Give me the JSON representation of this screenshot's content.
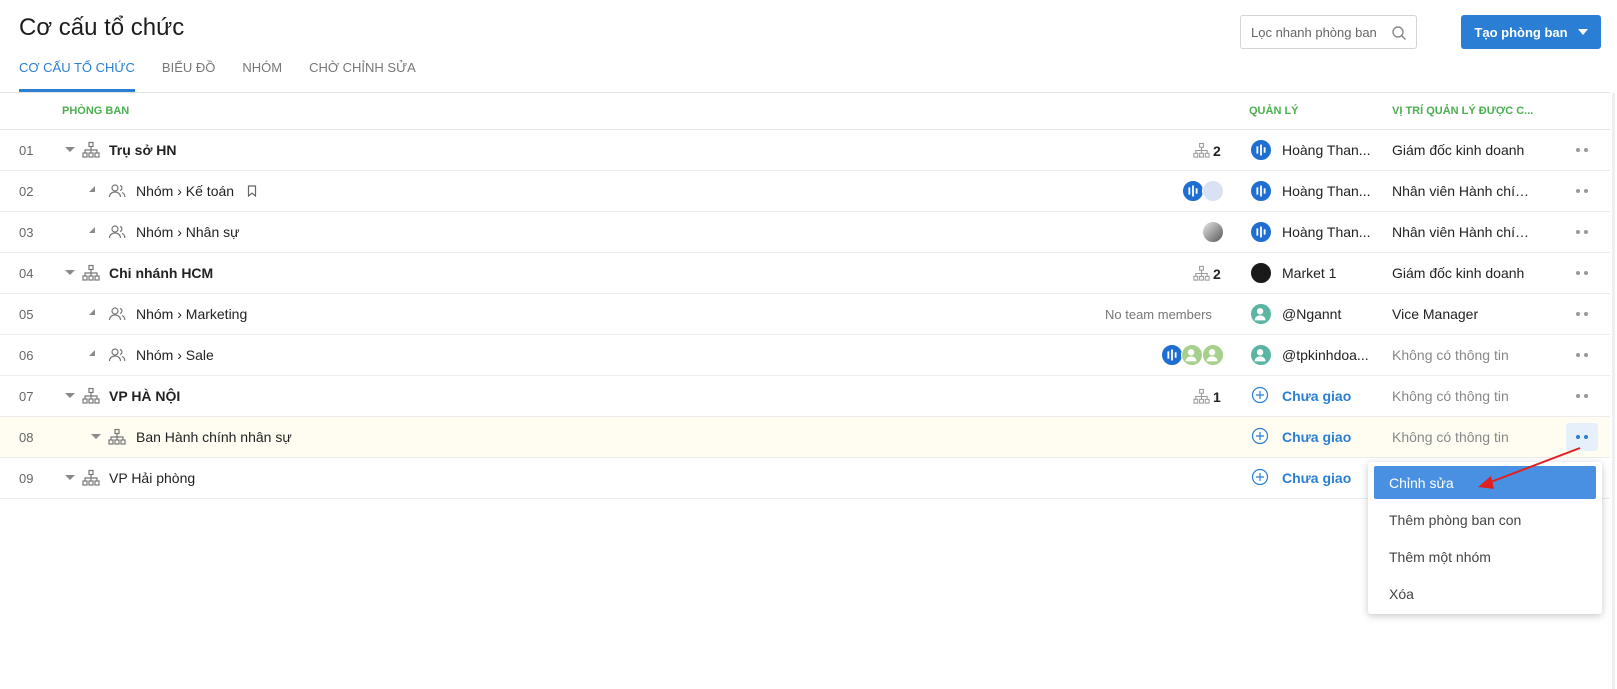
{
  "page": {
    "title": "Cơ cấu tổ chức"
  },
  "tabs": [
    {
      "label": "CƠ CẤU TỔ CHỨC",
      "active": true
    },
    {
      "label": "BIỂU ĐỒ",
      "active": false
    },
    {
      "label": "NHÓM",
      "active": false
    },
    {
      "label": "CHỜ CHỈNH SỬA",
      "active": false
    }
  ],
  "search": {
    "placeholder": "Lọc nhanh phòng ban",
    "value": ""
  },
  "create_button": {
    "label": "Tạo phòng ban"
  },
  "columns": {
    "department": "PHÒNG BAN",
    "manager": "QUẢN LÝ",
    "position": "VỊ TRÍ QUẢN LÝ ĐƯỢC C..."
  },
  "rows": [
    {
      "num": "01",
      "name": "Trụ sở HN",
      "type": "department",
      "subcount": "2",
      "manager": "Hoàng Than...",
      "position": "Giám đốc kinh doanh"
    },
    {
      "num": "02",
      "name": "Nhóm › Kế toán",
      "type": "team",
      "manager": "Hoàng Than...",
      "position": "Nhân viên Hành chín..."
    },
    {
      "num": "03",
      "name": "Nhóm › Nhân sự",
      "type": "team",
      "manager": "Hoàng Than...",
      "position": "Nhân viên Hành chín..."
    },
    {
      "num": "04",
      "name": "Chi nhánh HCM",
      "type": "department",
      "subcount": "2",
      "manager": "Market 1",
      "position": "Giám đốc kinh doanh"
    },
    {
      "num": "05",
      "name": "Nhóm › Marketing",
      "type": "team",
      "members_text": "No team members",
      "manager": "@Ngannt",
      "position": "Vice Manager"
    },
    {
      "num": "06",
      "name": "Nhóm › Sale",
      "type": "team",
      "manager": "@tpkinhdoa...",
      "position": "Không có thông tin"
    },
    {
      "num": "07",
      "name": "VP HÀ NỘI",
      "type": "department",
      "subcount": "1",
      "manager": "Chưa giao",
      "position": "Không có thông tin"
    },
    {
      "num": "08",
      "name": "Ban Hành chính nhân sự",
      "type": "department",
      "manager": "Chưa giao",
      "position": "Không có thông tin"
    },
    {
      "num": "09",
      "name": "VP Hải phòng",
      "type": "department",
      "manager": "Chưa giao"
    }
  ],
  "context_menu": {
    "items": [
      {
        "label": "Chỉnh sửa",
        "active": true
      },
      {
        "label": "Thêm phòng ban con",
        "active": false
      },
      {
        "label": "Thêm một nhóm",
        "active": false
      },
      {
        "label": "Xóa",
        "active": false
      }
    ]
  },
  "colors": {
    "accent": "#2a7fd4",
    "header_green": "#4caf50",
    "menu_active": "#4a90e2",
    "annotation_arrow": "#e02020"
  }
}
